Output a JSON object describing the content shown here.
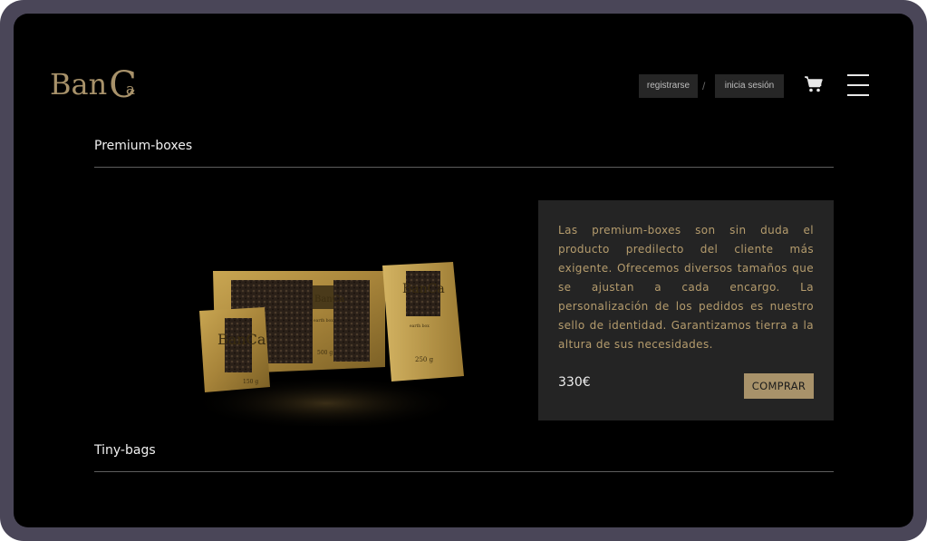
{
  "header": {
    "logo_text": "BanCa",
    "logo_parts": {
      "a": "Ban",
      "b": "C",
      "c": "a"
    },
    "register_label": "registrarse",
    "separator": "/",
    "login_label": "inicia sesión",
    "cart_icon": "cart-icon",
    "menu_icon": "hamburger-menu-icon"
  },
  "sections": [
    {
      "title": "Premium-boxes",
      "description": "Las premium-boxes son sin duda el producto predilecto del cliente más exigente. Ofrecemos diversos tamaños que se ajustan a cada encargo. La personalización de los pedidos es nuestro sello de identidad. Garantizamos tierra a la altura de sus necesidades.",
      "price": "330€",
      "buy_label": "COMPRAR",
      "image_labels": {
        "logo": "BanCa",
        "tagline": "earth box",
        "weight_large": "500 g",
        "weight_right": "250 g",
        "weight_small": "150 g"
      }
    },
    {
      "title": "Tiny-bags"
    }
  ],
  "colors": {
    "accent": "#a8926a",
    "background": "#000000",
    "panel": "#242424",
    "frame": "#4a4658"
  }
}
